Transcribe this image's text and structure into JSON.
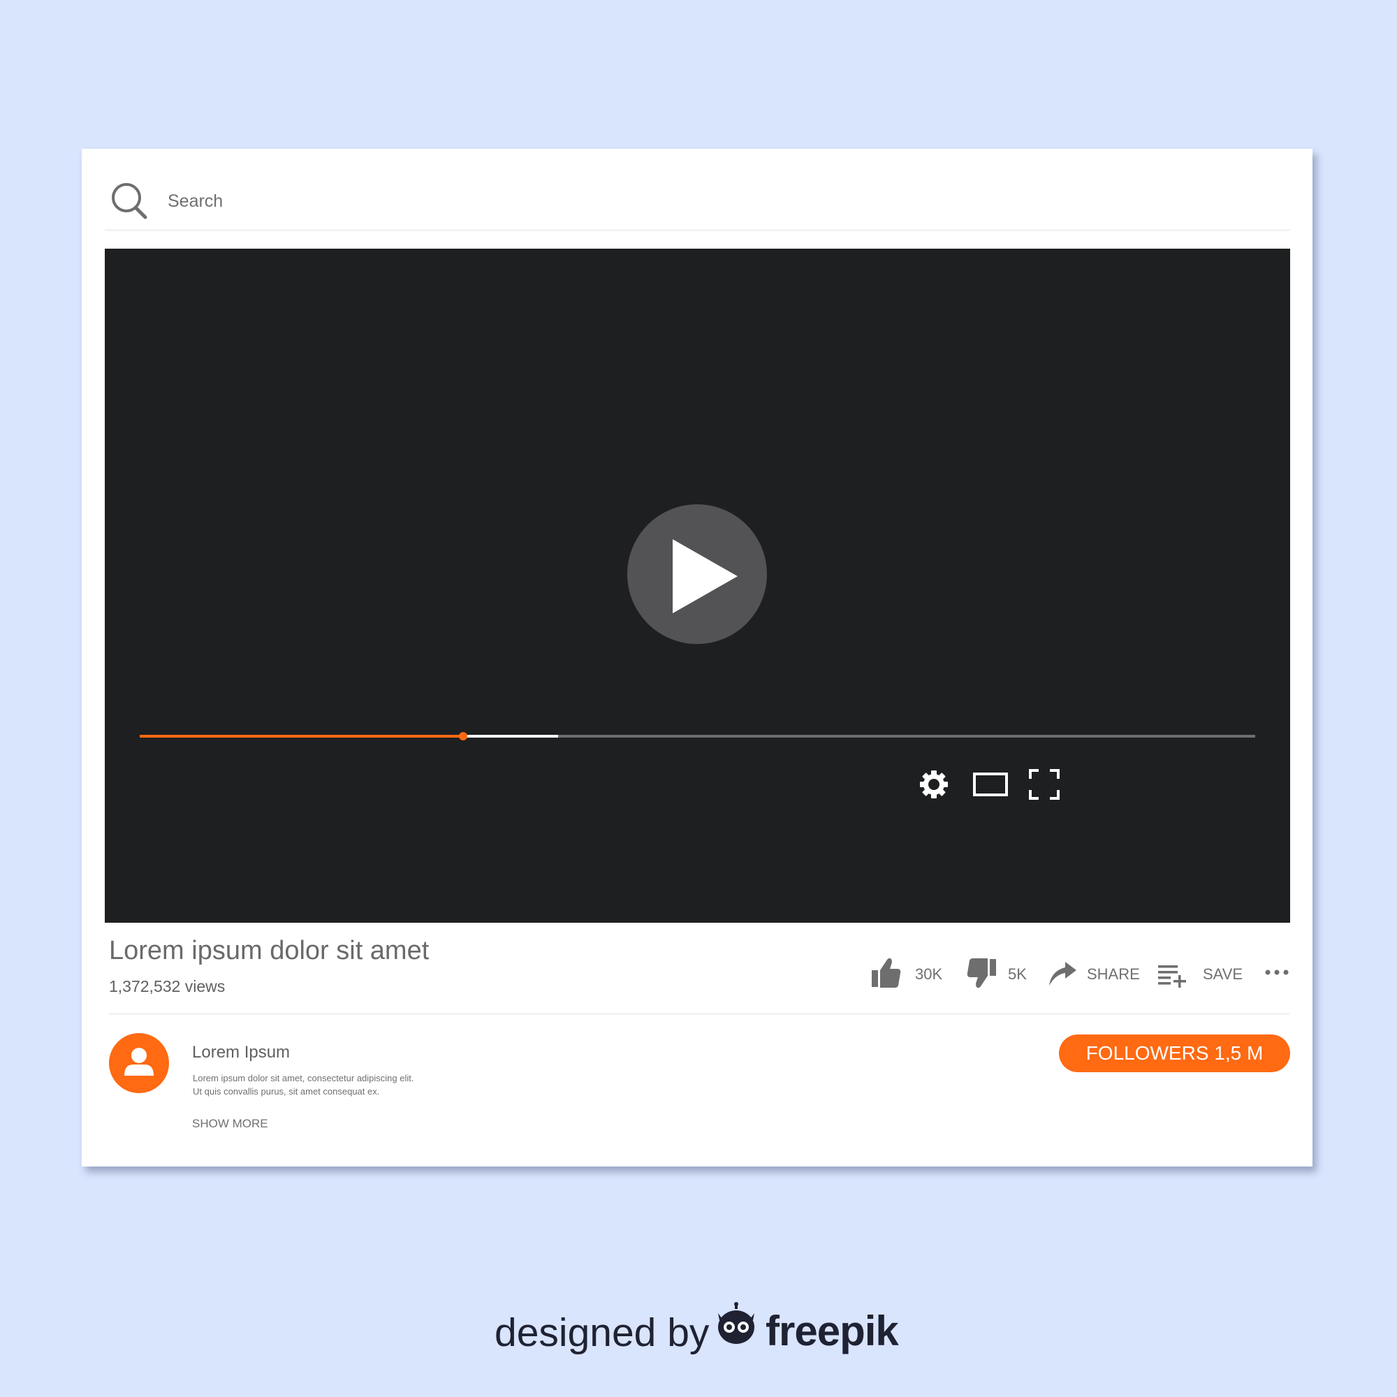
{
  "search": {
    "placeholder": "Search",
    "icon": "search-icon"
  },
  "player": {
    "play_icon": "play-icon",
    "progress": {
      "played_fraction": 0.29,
      "buffered_fraction": 0.375
    },
    "controls": [
      "gear-icon",
      "theater-mode-icon",
      "fullscreen-icon"
    ]
  },
  "video": {
    "title": "Lorem ipsum dolor sit amet",
    "views": "1,372,532 views"
  },
  "actions": {
    "likes": "30K",
    "dislikes": "5K",
    "share_label": "SHARE",
    "save_label": "SAVE",
    "more_icon": "more-icon"
  },
  "channel": {
    "name": "Lorem Ipsum",
    "description_lines": [
      "Lorem ipsum dolor sit amet, consectetur adipiscing elit.",
      "Ut quis convallis purus, sit amet consequat ex."
    ],
    "show_more_label": "SHOW MORE",
    "followers_label": "FOLLOWERS 1,5 M"
  },
  "credit": {
    "prefix": "designed by",
    "brand": "freepik"
  },
  "colors": {
    "background": "#d9e4fd",
    "accent": "#ff6a13",
    "video_bg": "#1e1f21",
    "text_gray": "#707070"
  }
}
